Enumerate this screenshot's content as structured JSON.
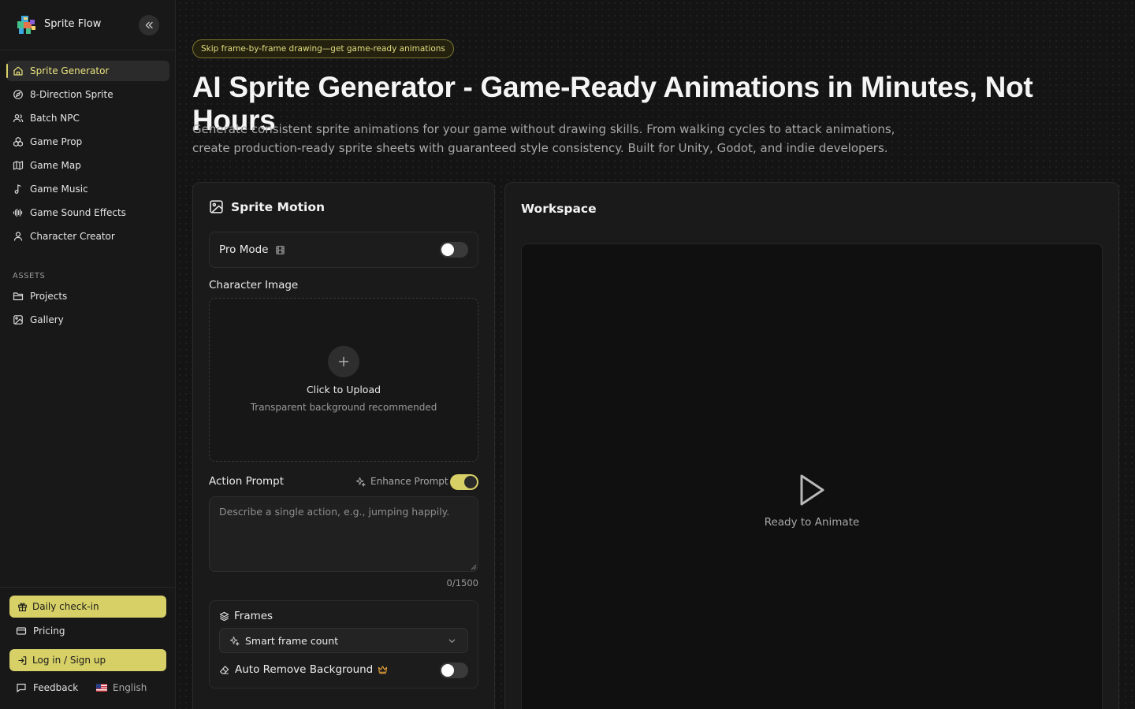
{
  "brand": {
    "name": "Sprite Flow"
  },
  "sidebar": {
    "items": [
      {
        "label": "Sprite Generator",
        "icon": "home-icon",
        "active": true
      },
      {
        "label": "8-Direction Sprite",
        "icon": "compass-icon"
      },
      {
        "label": "Batch NPC",
        "icon": "users-icon"
      },
      {
        "label": "Game Prop",
        "icon": "boxes-icon"
      },
      {
        "label": "Game Map",
        "icon": "map-icon"
      },
      {
        "label": "Game Music",
        "icon": "music-icon"
      },
      {
        "label": "Game Sound Effects",
        "icon": "audio-waveform-icon"
      },
      {
        "label": "Character Creator",
        "icon": "user-icon"
      }
    ],
    "assets_label": "ASSETS",
    "assets": [
      {
        "label": "Projects",
        "icon": "folder-icon"
      },
      {
        "label": "Gallery",
        "icon": "image-icon"
      }
    ],
    "footer": {
      "daily_checkin": "Daily check-in",
      "pricing": "Pricing",
      "login": "Log in / Sign up",
      "feedback": "Feedback",
      "language": "English"
    }
  },
  "hero": {
    "badge": "Skip frame-by-frame drawing—get game-ready animations",
    "title": "AI Sprite Generator - Game-Ready Animations in Minutes, Not Hours",
    "subtitle_line1": "Generate consistent sprite animations for your game without drawing skills. From walking cycles to attack animations,",
    "subtitle_line2": "create production-ready sprite sheets with guaranteed style consistency. Built for Unity, Godot, and indie developers."
  },
  "sprite_motion": {
    "title": "Sprite Motion",
    "pro_mode_label": "Pro Mode",
    "pro_mode_on": false,
    "character_image_label": "Character Image",
    "upload_title": "Click to Upload",
    "upload_hint": "Transparent background recommended",
    "action_prompt_label": "Action Prompt",
    "enhance_prompt_label": "Enhance Prompt",
    "enhance_prompt_on": true,
    "prompt_value": "",
    "prompt_placeholder": "Describe a single action, e.g., jumping happily.",
    "char_count": "0/1500",
    "frames_label": "Frames",
    "frames_selected": "Smart frame count",
    "auto_remove_bg_label": "Auto Remove Background",
    "auto_remove_bg_on": false
  },
  "workspace": {
    "title": "Workspace",
    "status": "Ready to Animate"
  },
  "colors": {
    "accent": "#d7d067",
    "background": "#141414",
    "panel": "#1a1a1a"
  }
}
